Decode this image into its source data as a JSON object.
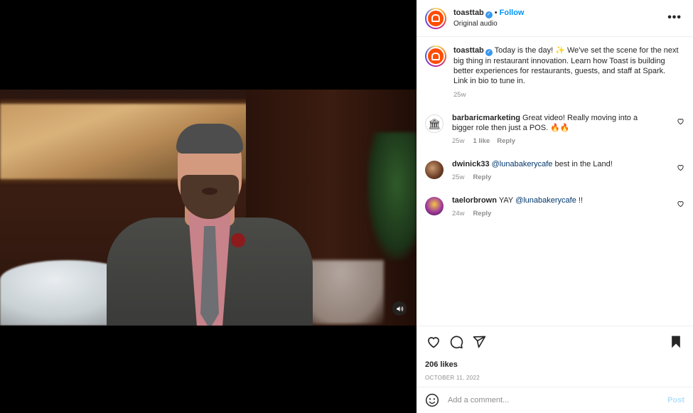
{
  "header": {
    "username": "toasttab",
    "verified": true,
    "separator": "•",
    "follow_label": "Follow",
    "audio_label": "Original audio",
    "more_label": "•••"
  },
  "caption": {
    "username": "toasttab",
    "text": "Today is the day! ✨ We've set the scene for the next big thing in restaurant innovation. Learn how Toast is building better experiences for restaurants, guests, and staff at Spark. Link in bio to tune in.",
    "age": "25w"
  },
  "comments": [
    {
      "username": "barbaricmarketing",
      "text": "Great video! Really moving into a bigger role then just a POS. 🔥🔥",
      "age": "25w",
      "likes": "1 like",
      "reply_label": "Reply"
    },
    {
      "username": "dwinick33",
      "mention": "@lunabakerycafe",
      "text": " best in the Land!",
      "age": "25w",
      "reply_label": "Reply"
    },
    {
      "username": "taelorbrown",
      "prefix": "YAY ",
      "mention": "@lunabakerycafe",
      "text": " !!",
      "age": "24w",
      "reply_label": "Reply"
    }
  ],
  "actions": {
    "likes_text": "206 likes",
    "date": "OCTOBER 11, 2022"
  },
  "add_comment": {
    "placeholder": "Add a comment...",
    "post_label": "Post"
  },
  "icons": [
    "mute-icon",
    "heart-icon",
    "comment-icon",
    "share-icon",
    "bookmark-icon",
    "emoji-icon",
    "more-icon"
  ],
  "colors": {
    "accent": "#0095f6",
    "brand": "#ff4c00",
    "post_disabled": "#b2dffc"
  }
}
